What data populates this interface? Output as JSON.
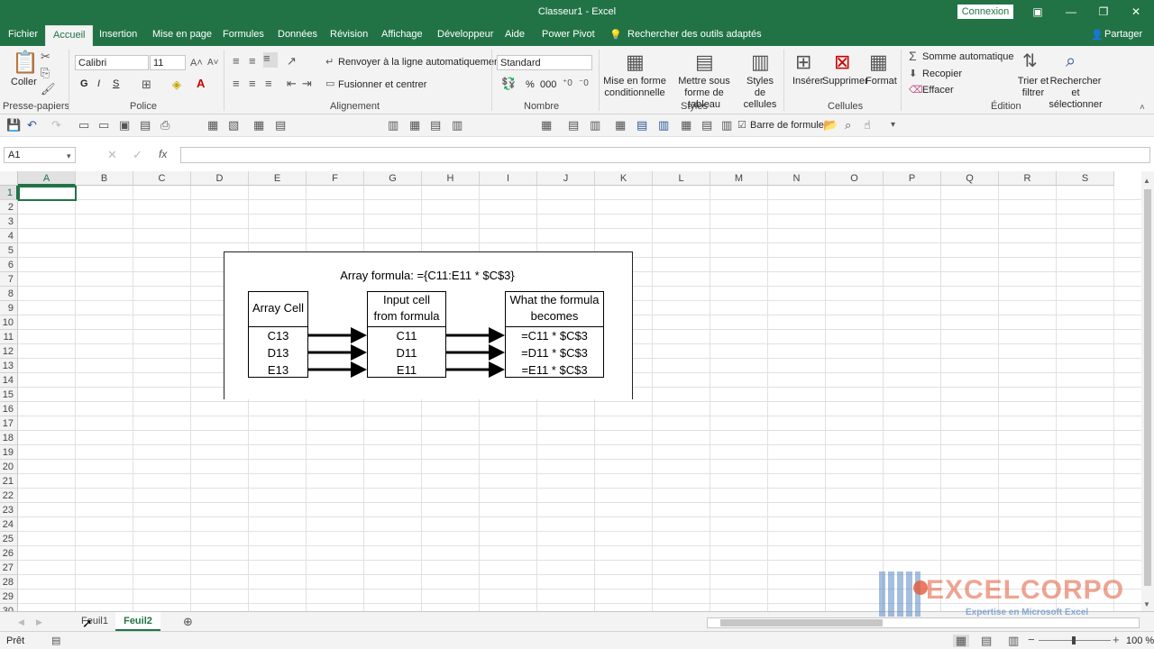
{
  "title_bar": {
    "title": "Classeur1  -  Excel",
    "signin_label": "Connexion"
  },
  "tabs": [
    {
      "label": "Fichier"
    },
    {
      "label": "Accueil"
    },
    {
      "label": "Insertion"
    },
    {
      "label": "Mise en page"
    },
    {
      "label": "Formules"
    },
    {
      "label": "Données"
    },
    {
      "label": "Révision"
    },
    {
      "label": "Affichage"
    },
    {
      "label": "Développeur"
    },
    {
      "label": "Aide"
    },
    {
      "label": "Power Pivot"
    }
  ],
  "tell_me": "Rechercher des outils adaptés",
  "share_label": "Partager",
  "ribbon": {
    "clipboard": {
      "paste": "Coller",
      "group": "Presse-papiers"
    },
    "font": {
      "name": "Calibri",
      "size": "11",
      "bold": "G",
      "italic": "I",
      "underline": "S",
      "group": "Police"
    },
    "alignment": {
      "wrap": "Renvoyer à la ligne automatiquement",
      "merge": "Fusionner et centrer",
      "group": "Alignement"
    },
    "number": {
      "format": "Standard",
      "percent": "%",
      "thousands": "000",
      "group": "Nombre"
    },
    "styles": {
      "conditional": "Mise en forme conditionnelle",
      "table": "Mettre sous forme de tableau",
      "cell_styles": "Styles de cellules",
      "group": "Styles"
    },
    "cells": {
      "insert": "Insérer",
      "delete": "Supprimer",
      "format": "Format",
      "group": "Cellules"
    },
    "editing": {
      "autosum": "Somme automatique",
      "fill": "Recopier",
      "clear": "Effacer",
      "sort": "Trier et filtrer",
      "find": "Rechercher et sélectionner",
      "group": "Édition"
    }
  },
  "qat": {
    "formula_bar_label": "Barre de formule"
  },
  "formula_bar": {
    "name_box": "A1",
    "fx": "fx",
    "content": ""
  },
  "columns": [
    "A",
    "B",
    "C",
    "D",
    "E",
    "F",
    "G",
    "H",
    "I",
    "J",
    "K",
    "L",
    "M",
    "N",
    "O",
    "P",
    "Q",
    "R",
    "S"
  ],
  "rows": [
    "1",
    "2",
    "3",
    "4",
    "5",
    "6",
    "7",
    "8",
    "9",
    "10",
    "11",
    "12",
    "13",
    "14",
    "15",
    "16",
    "17",
    "18",
    "19",
    "20",
    "21",
    "22",
    "23",
    "24",
    "25",
    "26",
    "27",
    "28",
    "29",
    "30"
  ],
  "diagram": {
    "title": "Array formula: ={C11:E11 * $C$3}",
    "col1": {
      "header": "Array Cell",
      "cells": [
        "C13",
        "D13",
        "E13"
      ]
    },
    "col2": {
      "header_line1": "Input cell",
      "header_line2": "from formula",
      "cells": [
        "C11",
        "D11",
        "E11"
      ]
    },
    "col3": {
      "header_line1": "What the formula",
      "header_line2": "becomes",
      "cells": [
        "=C11 * $C$3",
        "=D11 * $C$3",
        "=E11 * $C$3"
      ]
    }
  },
  "sheets": [
    {
      "name": "Feuil1"
    },
    {
      "name": "Feuil2"
    }
  ],
  "status": {
    "ready": "Prêt",
    "zoom": "100 %"
  },
  "watermark": {
    "brand": "EXCELCORPO",
    "tagline": "Expertise en Microsoft Excel"
  },
  "colors": {
    "accent": "#217346",
    "selection": "#217346"
  }
}
